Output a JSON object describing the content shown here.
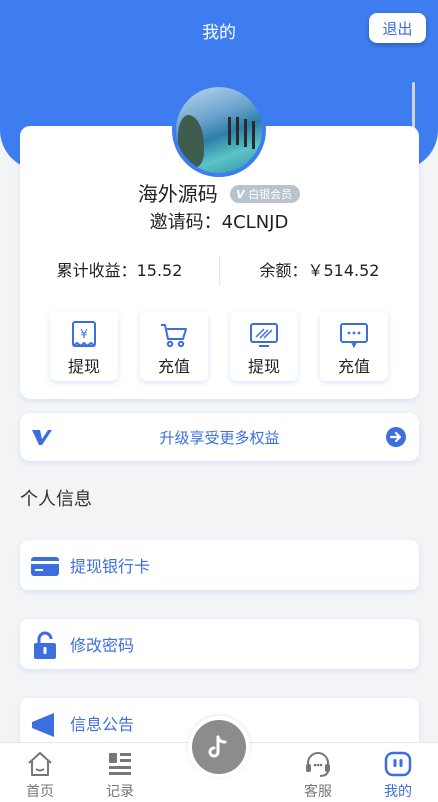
{
  "header": {
    "title": "我的",
    "logout_label": "退出"
  },
  "profile": {
    "name": "海外源码",
    "badge": "白银会员",
    "invite_label": "邀请码：",
    "invite_code": "4CLNJD"
  },
  "stats": {
    "earnings_label": "累计收益：",
    "earnings_value": "15.52",
    "balance_label": "余额：",
    "balance_value": "￥514.52"
  },
  "actions": [
    {
      "label": "提现",
      "icon": "withdraw-receipt-icon"
    },
    {
      "label": "充值",
      "icon": "cart-icon"
    },
    {
      "label": "提现",
      "icon": "screen-icon"
    },
    {
      "label": "充值",
      "icon": "chat-monitor-icon"
    }
  ],
  "upgrade": {
    "label": "升级享受更多权益"
  },
  "personal": {
    "title": "个人信息",
    "items": [
      {
        "label": "提现银行卡",
        "icon": "bank-card-icon"
      },
      {
        "label": "修改密码",
        "icon": "lock-icon"
      },
      {
        "label": "信息公告",
        "icon": "megaphone-icon"
      }
    ]
  },
  "tabbar": {
    "items": [
      {
        "label": "首页",
        "icon": "home-icon"
      },
      {
        "label": "记录",
        "icon": "list-icon"
      },
      {
        "label": "客服",
        "icon": "headset-icon"
      },
      {
        "label": "我的",
        "icon": "profile-icon"
      }
    ],
    "center_icon": "tiktok-icon"
  },
  "colors": {
    "primary": "#3d7df0",
    "accent_text": "#3d6ee0",
    "background": "#f3f4f6"
  }
}
